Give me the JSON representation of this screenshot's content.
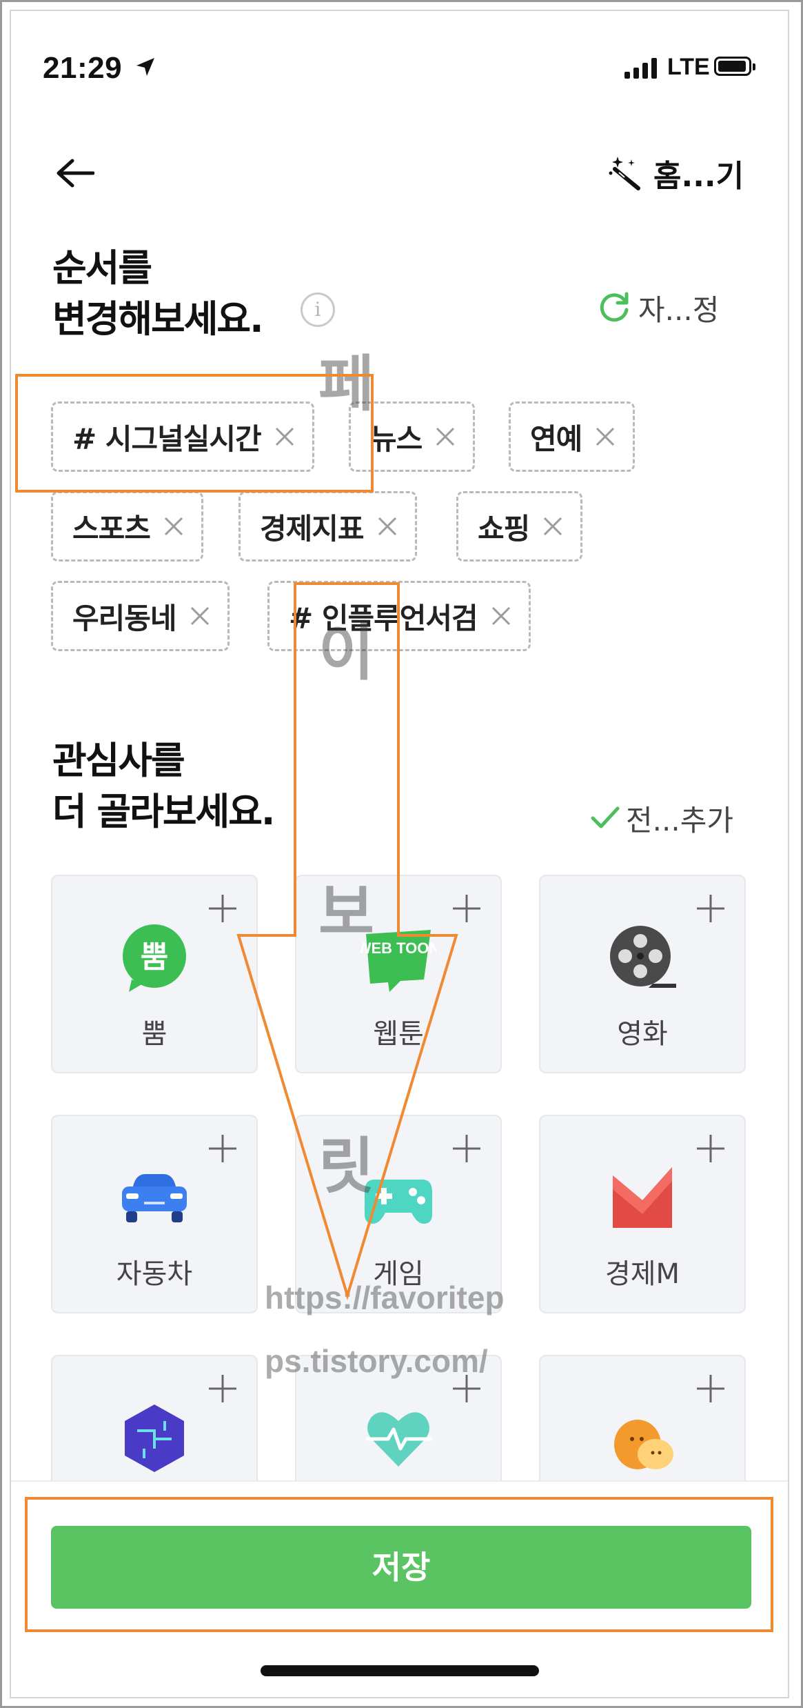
{
  "status_bar": {
    "time": "21:29",
    "network": "LTE"
  },
  "header": {
    "home_label": "홈...기"
  },
  "order_section": {
    "title_line1": "순서를",
    "title_line2": "변경해보세요.",
    "info_glyph": "i",
    "reset_label": "자...정",
    "chips": [
      {
        "label": "# 시그널실시간"
      },
      {
        "label": "뉴스"
      },
      {
        "label": "연예"
      },
      {
        "label": "스포츠"
      },
      {
        "label": "경제지표"
      },
      {
        "label": "쇼핑"
      },
      {
        "label": "우리동네"
      },
      {
        "label": "# 인플루언서검"
      }
    ]
  },
  "interest_section": {
    "title_line1": "관심사를",
    "title_line2": "더 골라보세요.",
    "add_all_label": "전...추가",
    "cards": [
      {
        "name": "뿜",
        "icon": "ppom-speech-bubble-icon",
        "icon_text": "뿜"
      },
      {
        "name": "웹툰",
        "icon": "webtoon-icon",
        "icon_text": "WEB TOON"
      },
      {
        "name": "영화",
        "icon": "film-reel-icon"
      },
      {
        "name": "자동차",
        "icon": "car-icon"
      },
      {
        "name": "게임",
        "icon": "gamepad-icon"
      },
      {
        "name": "경제M",
        "icon": "economy-m-icon"
      },
      {
        "name": "",
        "icon": "tech-hexagon-icon"
      },
      {
        "name": "",
        "icon": "heart-pulse-icon"
      },
      {
        "name": "",
        "icon": "characters-icon"
      }
    ]
  },
  "save_button": {
    "label": "저장"
  },
  "watermark": {
    "chars": [
      "페",
      "이",
      "보",
      "릿"
    ],
    "url_line1": "https://favoritep",
    "url_line2": "ps.tistory.com/"
  },
  "colors": {
    "accent_green": "#5ac463",
    "annotation_orange": "#f08a32"
  }
}
